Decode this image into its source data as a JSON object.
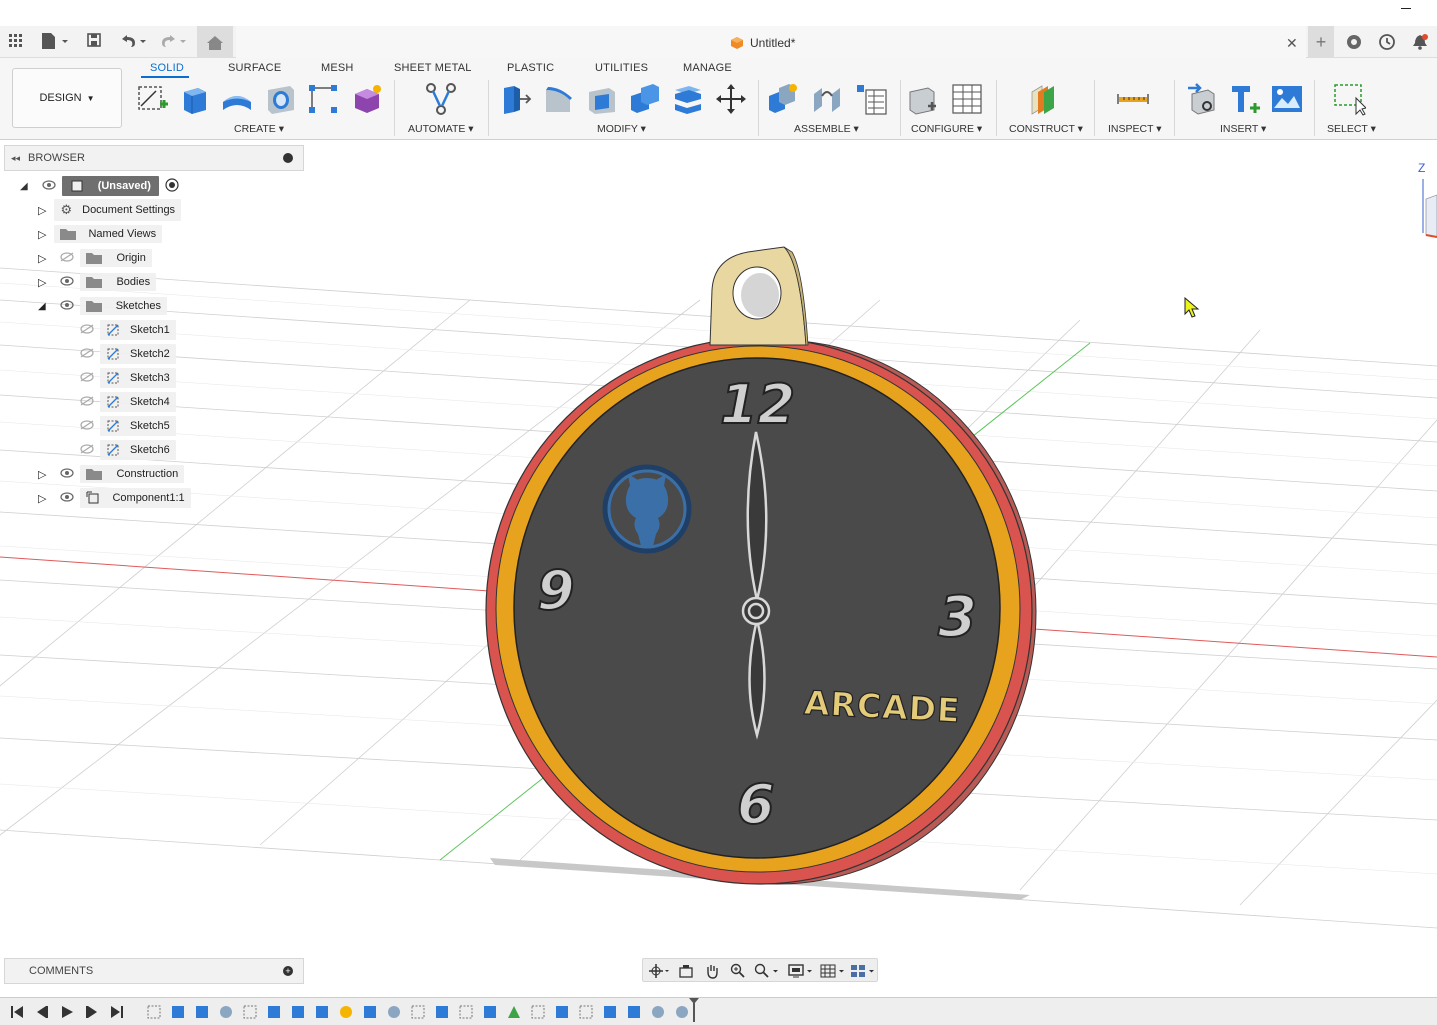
{
  "window": {
    "title": "Untitled*"
  },
  "toolbar": {
    "workspace_label": "DESIGN",
    "tabs": [
      {
        "label": "SOLID",
        "active": true
      },
      {
        "label": "SURFACE",
        "active": false
      },
      {
        "label": "MESH",
        "active": false
      },
      {
        "label": "SHEET METAL",
        "active": false
      },
      {
        "label": "PLASTIC",
        "active": false
      },
      {
        "label": "UTILITIES",
        "active": false
      },
      {
        "label": "MANAGE",
        "active": false
      }
    ],
    "groups": {
      "create": "CREATE",
      "automate": "AUTOMATE",
      "modify": "MODIFY",
      "assemble": "ASSEMBLE",
      "configure": "CONFIGURE",
      "construct": "CONSTRUCT",
      "inspect": "INSPECT",
      "insert": "INSERT",
      "select": "SELECT"
    }
  },
  "browser": {
    "title": "BROWSER",
    "root": "(Unsaved)",
    "items": [
      {
        "label": "Document Settings",
        "icon": "gear-icon"
      },
      {
        "label": "Named Views",
        "icon": "folder-icon"
      },
      {
        "label": "Origin",
        "icon": "folder-icon"
      },
      {
        "label": "Bodies",
        "icon": "folder-icon"
      },
      {
        "label": "Sketches",
        "icon": "folder-icon"
      },
      {
        "label": "Construction",
        "icon": "folder-icon"
      },
      {
        "label": "Component1:1",
        "icon": "component-icon"
      }
    ],
    "sketches": [
      "Sketch1",
      "Sketch2",
      "Sketch3",
      "Sketch4",
      "Sketch5",
      "Sketch6"
    ]
  },
  "comments": {
    "title": "COMMENTS"
  },
  "model": {
    "numerals": [
      "12",
      "3",
      "6",
      "9"
    ],
    "brand_text": "ARCADE"
  },
  "viewcube": {
    "axis": "Z"
  },
  "colors": {
    "accent": "#0a6ed1",
    "face": "#4a4a4a",
    "rim_outer": "#d9534f",
    "rim_inner": "#e8a31e",
    "loop": "#e8d7a0",
    "logo": "#3b6fa8",
    "brand_text": "#e3cb7a"
  }
}
